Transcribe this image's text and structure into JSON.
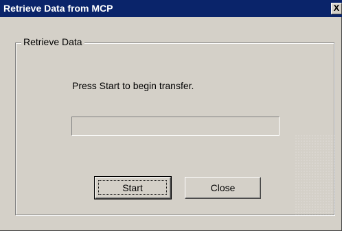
{
  "window": {
    "title": "Retrieve Data from MCP",
    "close_glyph": "X",
    "close_icon": "close-icon"
  },
  "group": {
    "legend": "Retrieve Data"
  },
  "main": {
    "instruction": "Press Start to begin transfer.",
    "progress_fraction": 0
  },
  "buttons": {
    "start_label": "Start",
    "close_label": "Close"
  },
  "colors": {
    "titlebar": "#0a246a",
    "face": "#d4d0c8",
    "title_text": "#ffffff"
  }
}
